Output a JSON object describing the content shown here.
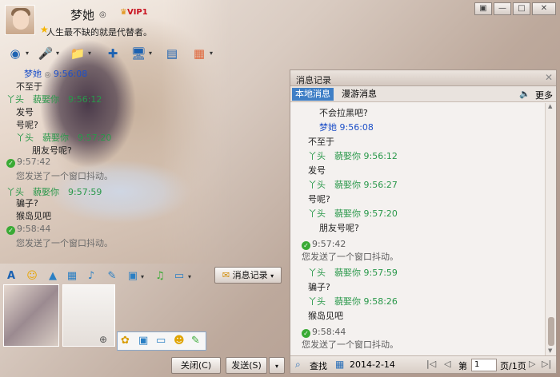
{
  "window": {
    "nickname": "梦她",
    "vip_badge": "VIP1",
    "signature": "人生最不缺的就是代替者。"
  },
  "chat": [
    {
      "type": "name",
      "sender": "梦她",
      "time": "9:56:08",
      "color": "blue"
    },
    {
      "type": "text",
      "text": "不至于"
    },
    {
      "type": "name",
      "sender": "丫头　藐娶你",
      "time": "9:56:12",
      "color": "green"
    },
    {
      "type": "text",
      "text": "发号"
    },
    {
      "type": "text",
      "text": "号呢?"
    },
    {
      "type": "name",
      "sender": "丫头　藐娶你",
      "time": "9:57:20",
      "color": "green"
    },
    {
      "type": "text",
      "text": "朋友号呢?"
    },
    {
      "type": "sys",
      "time": "9:57:42",
      "text": "您发送了一个窗口抖动。"
    },
    {
      "type": "name",
      "sender": "丫头　藐娶你",
      "time": "9:57:59",
      "color": "green"
    },
    {
      "type": "text",
      "text": "骗子?"
    },
    {
      "type": "text",
      "text": "猴岛见吧"
    },
    {
      "type": "sys",
      "time": "9:58:44",
      "text": "您发送了一个窗口抖动。"
    }
  ],
  "history": {
    "title": "消息记录",
    "tab_local": "本地消息",
    "tab_roam": "漫游消息",
    "more": "更多",
    "lines": [
      {
        "kind": "text",
        "text": "不会拉黑吧?",
        "indent": "wide"
      },
      {
        "kind": "name",
        "sender": "梦她",
        "time": "9:56:08",
        "color": "blue",
        "indent": "wide"
      },
      {
        "kind": "text",
        "text": "不至于",
        "indent": "narrow"
      },
      {
        "kind": "name",
        "sender": "丫头　藐娶你",
        "time": "9:56:12",
        "color": "green",
        "indent": "narrow"
      },
      {
        "kind": "text",
        "text": "发号",
        "indent": "narrow"
      },
      {
        "kind": "name",
        "sender": "丫头　藐娶你",
        "time": "9:56:27",
        "color": "green",
        "indent": "narrow"
      },
      {
        "kind": "text",
        "text": "号呢?",
        "indent": "narrow"
      },
      {
        "kind": "name",
        "sender": "丫头　藐娶你",
        "time": "9:57:20",
        "color": "green",
        "indent": "narrow"
      },
      {
        "kind": "text",
        "text": "朋友号呢?",
        "indent": "wide"
      },
      {
        "kind": "sys",
        "time": "9:57:42",
        "text": "您发送了一个窗口抖动。"
      },
      {
        "kind": "name",
        "sender": "丫头　藐娶你",
        "time": "9:57:59",
        "color": "green",
        "indent": "narrow"
      },
      {
        "kind": "text",
        "text": "骗子?",
        "indent": "narrow"
      },
      {
        "kind": "name",
        "sender": "丫头　藐娶你",
        "time": "9:58:26",
        "color": "green",
        "indent": "narrow"
      },
      {
        "kind": "text",
        "text": "猴岛见吧",
        "indent": "narrow"
      },
      {
        "kind": "sys",
        "time": "9:58:44",
        "text": "您发送了一个窗口抖动。"
      }
    ],
    "search": "查找",
    "date": "2014-2-14",
    "page_prefix": "第",
    "page_value": "1",
    "page_suffix": "页/1页"
  },
  "input_toolbar": {
    "history_button": "消息记录"
  },
  "buttons": {
    "close": "关闭(C)",
    "send": "发送(S)"
  }
}
